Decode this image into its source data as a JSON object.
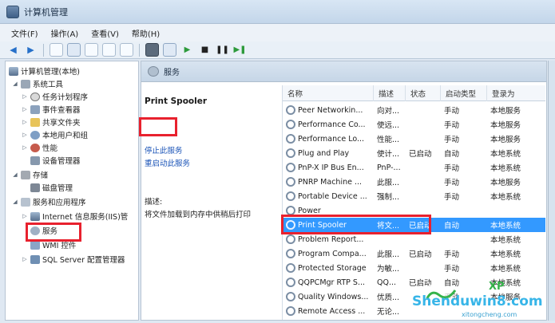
{
  "window": {
    "title": "计算机管理"
  },
  "menu": [
    "文件(F)",
    "操作(A)",
    "查看(V)",
    "帮助(H)"
  ],
  "tree": {
    "root": "计算机管理(本地)",
    "system_tools": "系统工具",
    "task_scheduler": "任务计划程序",
    "event_viewer": "事件查看器",
    "shared_folders": "共享文件夹",
    "local_users": "本地用户和组",
    "performance": "性能",
    "device_manager": "设备管理器",
    "storage": "存储",
    "disk_mgmt": "磁盘管理",
    "services_apps": "服务和应用程序",
    "iis": "Internet 信息服务(IIS)管",
    "services": "服务",
    "wmi": "WMI 控件",
    "sql": "SQL Server 配置管理器"
  },
  "header": {
    "label": "服务"
  },
  "detail": {
    "service_name": "Print Spooler",
    "stop_link": "停止此服务",
    "restart_link": "重启动此服务",
    "desc_label": "描述:",
    "desc_text": "将文件加载到内存中供稍后打印"
  },
  "columns": [
    "名称",
    "描述",
    "状态",
    "启动类型",
    "登录为"
  ],
  "rows": [
    {
      "name": "Peer Networkin...",
      "desc": "向对...",
      "status": "",
      "startup": "手动",
      "logon": "本地服务"
    },
    {
      "name": "Performance Co...",
      "desc": "使远...",
      "status": "",
      "startup": "手动",
      "logon": "本地服务"
    },
    {
      "name": "Performance Lo...",
      "desc": "性能...",
      "status": "",
      "startup": "手动",
      "logon": "本地服务"
    },
    {
      "name": "Plug and Play",
      "desc": "使计...",
      "status": "已启动",
      "startup": "自动",
      "logon": "本地系统"
    },
    {
      "name": "PnP-X IP Bus En...",
      "desc": "PnP-...",
      "status": "",
      "startup": "手动",
      "logon": "本地系统"
    },
    {
      "name": "PNRP Machine ...",
      "desc": "此服...",
      "status": "",
      "startup": "手动",
      "logon": "本地服务"
    },
    {
      "name": "Portable Device ...",
      "desc": "强制...",
      "status": "",
      "startup": "手动",
      "logon": "本地系统"
    },
    {
      "name": "Power",
      "desc": "",
      "status": "",
      "startup": "",
      "logon": ""
    },
    {
      "name": "Print Spooler",
      "desc": "将文...",
      "status": "已启动",
      "startup": "自动",
      "logon": "本地系统"
    },
    {
      "name": "Problem Report...",
      "desc": "",
      "status": "",
      "startup": "",
      "logon": "本地系统"
    },
    {
      "name": "Program Compa...",
      "desc": "此服...",
      "status": "已启动",
      "startup": "手动",
      "logon": "本地系统"
    },
    {
      "name": "Protected Storage",
      "desc": "为敏...",
      "status": "",
      "startup": "手动",
      "logon": "本地系统"
    },
    {
      "name": "QQPCMgr RTP S...",
      "desc": "QQ...",
      "status": "已启动",
      "startup": "自动",
      "logon": "本地系统"
    },
    {
      "name": "Quality Windows...",
      "desc": "优质...",
      "status": "",
      "startup": "手动",
      "logon": "本地服务"
    },
    {
      "name": "Remote Access ...",
      "desc": "无论...",
      "status": "",
      "startup": "",
      "logon": ""
    }
  ],
  "watermark": {
    "site": "Shenduwin8.com",
    "sub": "xitongcheng.com",
    "brand": "XP"
  },
  "colors": {
    "highlight": "#e8212e",
    "selection": "#3399ff"
  }
}
